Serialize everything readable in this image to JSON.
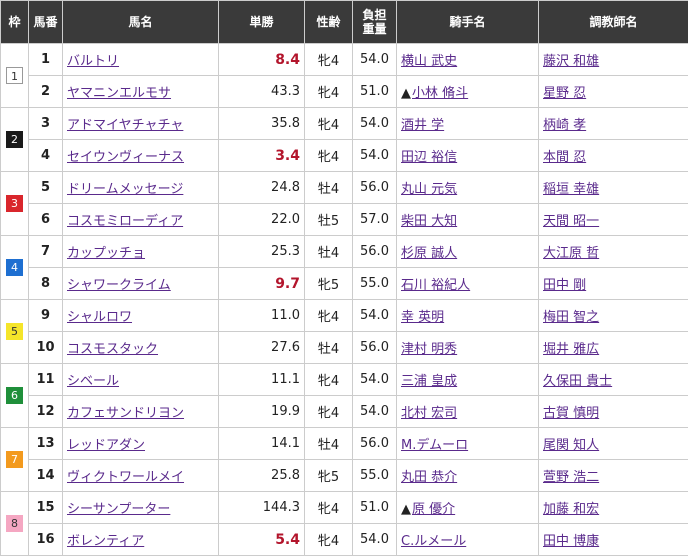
{
  "headers": {
    "waku": "枠",
    "umaban": "馬番",
    "horse": "馬名",
    "odds": "単勝",
    "sexage": "性齢",
    "weight_line1": "負担",
    "weight_line2": "重量",
    "jockey": "騎手名",
    "trainer": "調教師名"
  },
  "rows": [
    {
      "waku": "1",
      "waku_bg": "#ffffff",
      "waku_fg": "#333333",
      "num": "1",
      "horse": "バルトリ",
      "odds": "8.4",
      "top": true,
      "sex": "牝4",
      "weight": "54.0",
      "mark": "",
      "jockey": "横山 武史",
      "trainer": "藤沢 和雄"
    },
    {
      "waku": "",
      "num": "2",
      "horse": "ヤマニンエルモサ",
      "odds": "43.3",
      "top": false,
      "sex": "牝4",
      "weight": "51.0",
      "mark": "▲",
      "jockey": "小林 脩斗",
      "trainer": "星野 忍"
    },
    {
      "waku": "2",
      "waku_bg": "#1a1a1a",
      "waku_fg": "#ffffff",
      "num": "3",
      "horse": "アドマイヤチャチャ",
      "odds": "35.8",
      "top": false,
      "sex": "牝4",
      "weight": "54.0",
      "mark": "",
      "jockey": "酒井 学",
      "trainer": "柄崎 孝"
    },
    {
      "waku": "",
      "num": "4",
      "horse": "セイウンヴィーナス",
      "odds": "3.4",
      "top": true,
      "sex": "牝4",
      "weight": "54.0",
      "mark": "",
      "jockey": "田辺 裕信",
      "trainer": "本間 忍"
    },
    {
      "waku": "3",
      "waku_bg": "#d9262c",
      "waku_fg": "#ffffff",
      "num": "5",
      "horse": "ドリームメッセージ",
      "odds": "24.8",
      "top": false,
      "sex": "牡4",
      "weight": "56.0",
      "mark": "",
      "jockey": "丸山 元気",
      "trainer": "稲垣 幸雄"
    },
    {
      "waku": "",
      "num": "6",
      "horse": "コスモミローディア",
      "odds": "22.0",
      "top": false,
      "sex": "牡5",
      "weight": "57.0",
      "mark": "",
      "jockey": "柴田 大知",
      "trainer": "天間 昭一"
    },
    {
      "waku": "4",
      "waku_bg": "#1e6fd1",
      "waku_fg": "#ffffff",
      "num": "7",
      "horse": "カップッチョ",
      "odds": "25.3",
      "top": false,
      "sex": "牡4",
      "weight": "56.0",
      "mark": "",
      "jockey": "杉原 誠人",
      "trainer": "大江原 哲"
    },
    {
      "waku": "",
      "num": "8",
      "horse": "シャワークライム",
      "odds": "9.7",
      "top": true,
      "sex": "牝5",
      "weight": "55.0",
      "mark": "",
      "jockey": "石川 裕紀人",
      "trainer": "田中 剛"
    },
    {
      "waku": "5",
      "waku_bg": "#f5e52a",
      "waku_fg": "#333333",
      "num": "9",
      "horse": "シャルロワ",
      "odds": "11.0",
      "top": false,
      "sex": "牝4",
      "weight": "54.0",
      "mark": "",
      "jockey": "幸 英明",
      "trainer": "梅田 智之"
    },
    {
      "waku": "",
      "num": "10",
      "horse": "コスモスタック",
      "odds": "27.6",
      "top": false,
      "sex": "牡4",
      "weight": "56.0",
      "mark": "",
      "jockey": "津村 明秀",
      "trainer": "堀井 雅広"
    },
    {
      "waku": "6",
      "waku_bg": "#1f8f3a",
      "waku_fg": "#ffffff",
      "num": "11",
      "horse": "シベール",
      "odds": "11.1",
      "top": false,
      "sex": "牝4",
      "weight": "54.0",
      "mark": "",
      "jockey": "三浦 皇成",
      "trainer": "久保田 貴士"
    },
    {
      "waku": "",
      "num": "12",
      "horse": "カフェサンドリヨン",
      "odds": "19.9",
      "top": false,
      "sex": "牝4",
      "weight": "54.0",
      "mark": "",
      "jockey": "北村 宏司",
      "trainer": "古賀 慎明"
    },
    {
      "waku": "7",
      "waku_bg": "#f39a1e",
      "waku_fg": "#ffffff",
      "num": "13",
      "horse": "レッドアダン",
      "odds": "14.1",
      "top": false,
      "sex": "牡4",
      "weight": "56.0",
      "mark": "",
      "jockey": "M.デムーロ",
      "trainer": "尾関 知人"
    },
    {
      "waku": "",
      "num": "14",
      "horse": "ヴィクトワールメイ",
      "odds": "25.8",
      "top": false,
      "sex": "牝5",
      "weight": "55.0",
      "mark": "",
      "jockey": "丸田 恭介",
      "trainer": "萱野 浩二"
    },
    {
      "waku": "8",
      "waku_bg": "#f5a7c2",
      "waku_fg": "#333333",
      "num": "15",
      "horse": "シーサンプーター",
      "odds": "144.3",
      "top": false,
      "sex": "牝4",
      "weight": "51.0",
      "mark": "▲",
      "jockey": "原 優介",
      "trainer": "加藤 和宏"
    },
    {
      "waku": "",
      "num": "16",
      "horse": "ボレンティア",
      "odds": "5.4",
      "top": true,
      "sex": "牝4",
      "weight": "54.0",
      "mark": "",
      "jockey": "C.ルメール",
      "trainer": "田中 博康"
    }
  ]
}
